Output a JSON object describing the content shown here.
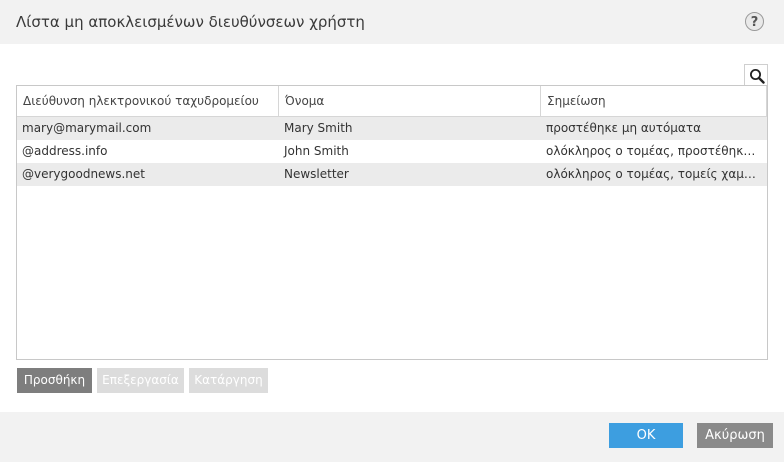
{
  "window": {
    "title": "Λίστα μη αποκλεισμένων διευθύνσεων χρήστη",
    "help_label": "?"
  },
  "search": {
    "icon": "search-icon"
  },
  "table": {
    "columns": [
      "Διεύθυνση ηλεκτρονικού ταχυδρομείου",
      "Όνομα",
      "Σημείωση"
    ],
    "rows": [
      {
        "email": "mary@marymail.com",
        "name": "Mary Smith",
        "note": "προστέθηκε μη αυτόματα"
      },
      {
        "email": "@address.info",
        "name": "John Smith",
        "note": "ολόκληρος ο τομέας, προστέθηκε μη …"
      },
      {
        "email": "@verygoodnews.net",
        "name": "Newsletter",
        "note": "ολόκληρος ο τομέας, τομείς χαμηλότε…"
      }
    ]
  },
  "actions": {
    "add": "Προσθήκη",
    "edit": "Επεξεργασία",
    "remove": "Κατάργηση"
  },
  "footer": {
    "ok": "OK",
    "cancel": "Ακύρωση"
  },
  "colors": {
    "primary": "#3d9ee0",
    "secondary": "#8a8a8a",
    "disabled": "#dcdcdc",
    "row_alt": "#ebebeb"
  }
}
